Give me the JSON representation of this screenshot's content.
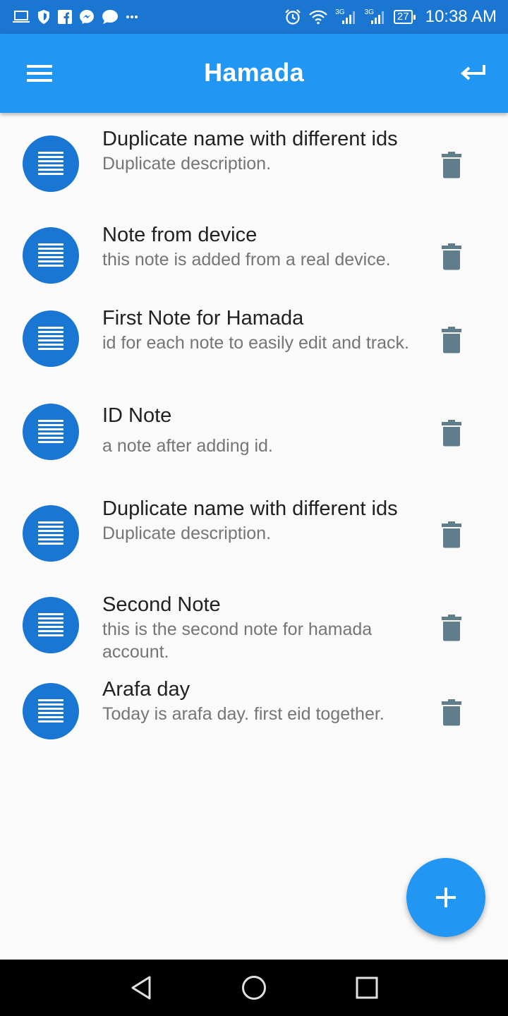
{
  "status_bar": {
    "time": "10:38 AM",
    "battery": "27",
    "network_1": "3G",
    "network_2": "3G",
    "left_icons": [
      "laptop-icon",
      "shield-icon",
      "facebook-icon",
      "messenger-icon",
      "chat-icon",
      "more-icon"
    ],
    "right_icons": [
      "alarm-icon",
      "wifi-icon",
      "signal-icon",
      "signal-icon",
      "battery-icon"
    ]
  },
  "app_bar": {
    "title": "Hamada",
    "menu_icon": "menu-icon",
    "back_icon": "return-icon"
  },
  "notes": [
    {
      "title": "Duplicate name with different ids",
      "description": "Duplicate description."
    },
    {
      "title": "Note from device",
      "description": "this note is added from a real device."
    },
    {
      "title": "First Note for Hamada",
      "description": "id for each note to easily edit and track."
    },
    {
      "title": "ID Note",
      "description": "a note after adding id."
    },
    {
      "title": "Duplicate name with different ids",
      "description": "Duplicate description."
    },
    {
      "title": "Second Note",
      "description": "this is the second note for hamada account."
    },
    {
      "title": "Arafa day",
      "description": "Today is arafa day. first eid together."
    }
  ],
  "fab": {
    "icon": "plus-icon"
  },
  "colors": {
    "status_bar": "#1b76d1",
    "app_bar": "#2196f3",
    "avatar": "#1976d2",
    "delete_icon": "#607d8b",
    "background": "#fafafa"
  }
}
